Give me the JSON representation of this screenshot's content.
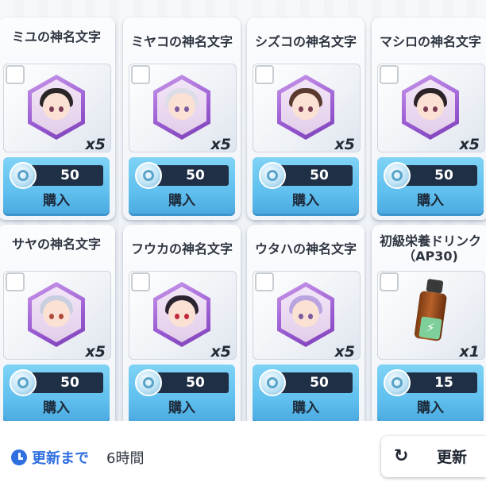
{
  "shop": {
    "items": [
      {
        "title": "ミユの神名文字",
        "quantity": "x5",
        "price": "50",
        "buy_label": "購入",
        "hair_color": "#2a2626",
        "kind": "char"
      },
      {
        "title": "ミヤコの神名文字",
        "quantity": "x5",
        "price": "50",
        "buy_label": "購入",
        "hair_color": "#dcdde6",
        "kind": "char"
      },
      {
        "title": "シズコの神名文字",
        "quantity": "x5",
        "price": "50",
        "buy_label": "購入",
        "hair_color": "#5a3a2e",
        "kind": "char"
      },
      {
        "title": "マシロの神名文字",
        "quantity": "x5",
        "price": "50",
        "buy_label": "購入",
        "hair_color": "#2b2326",
        "kind": "char"
      },
      {
        "title": "サヤの神名文字",
        "quantity": "x5",
        "price": "50",
        "buy_label": "購入",
        "hair_color": "#c9cfe0",
        "kind": "char"
      },
      {
        "title": "フウカの神名文字",
        "quantity": "x5",
        "price": "50",
        "buy_label": "購入",
        "hair_color": "#2b2330",
        "kind": "char"
      },
      {
        "title": "ウタハの神名文字",
        "quantity": "x5",
        "price": "50",
        "buy_label": "購入",
        "hair_color": "#b9a4e0",
        "kind": "char"
      },
      {
        "title": "初級栄養ドリンク（AP30)",
        "quantity": "x1",
        "price": "15",
        "buy_label": "購入",
        "kind": "drink"
      }
    ]
  },
  "footer": {
    "refresh_until_label": "更新まで",
    "refresh_time": "6時間",
    "refresh_button_label": "更新"
  },
  "colors": {
    "accent": "#2f6fe0",
    "price_bar": "#1f2f45",
    "buy_button": "#5fbfee",
    "hex_frame": "#9d5fd4"
  }
}
